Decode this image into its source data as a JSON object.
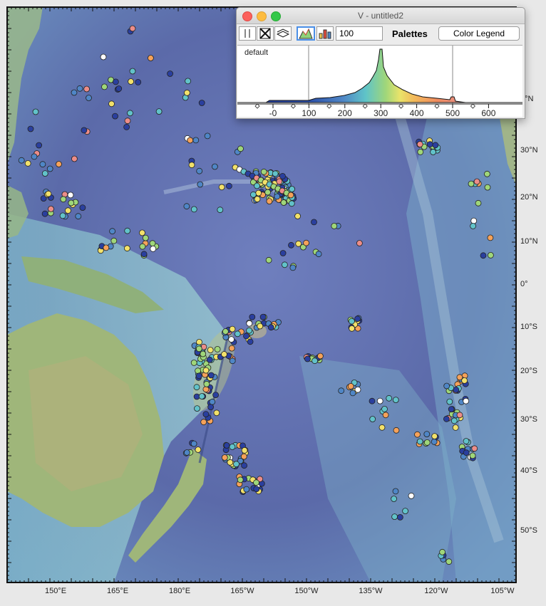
{
  "window": {
    "title": "V - untitled2",
    "value_field": "100",
    "palettes_label": "Palettes",
    "color_legend_button": "Color Legend",
    "palette_name": "default",
    "scale_labels": [
      "-0",
      "100",
      "200",
      "300",
      "400",
      "500",
      "600"
    ],
    "scale_values": [
      0,
      100,
      200,
      300,
      400,
      500,
      600
    ],
    "icons": [
      "split-icon",
      "close-x-icon",
      "layers-icon",
      "histogram-icon",
      "bar-chart-icon"
    ]
  },
  "axes": {
    "bottom": [
      "150°E",
      "165°E",
      "180°E",
      "165°W",
      "150°W",
      "135°W",
      "120°W",
      "105°W"
    ],
    "right": [
      "0°N",
      "30°N",
      "20°N",
      "10°N",
      "0°",
      "10°S",
      "20°S",
      "30°S",
      "40°S",
      "50°S"
    ]
  },
  "colors": {
    "palette": [
      "#2a3f9e",
      "#4f86c6",
      "#62c2c9",
      "#9fd67a",
      "#f2e16b",
      "#f5a25a",
      "#ec8d89",
      "#ffffff"
    ],
    "ocean_deep": "#5b6fae",
    "land": "#8fb07b"
  }
}
